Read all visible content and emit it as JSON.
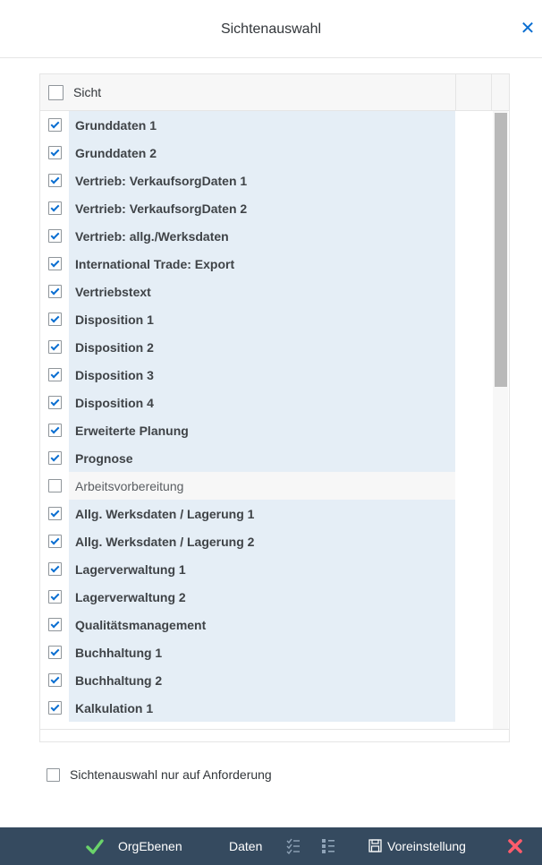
{
  "dialog": {
    "title": "Sichtenauswahl",
    "close_glyph": "✕"
  },
  "table": {
    "column_header": "Sicht",
    "header_checked": false,
    "rows": [
      {
        "label": "Grunddaten 1",
        "checked": true
      },
      {
        "label": "Grunddaten 2",
        "checked": true
      },
      {
        "label": "Vertrieb: VerkaufsorgDaten 1",
        "checked": true
      },
      {
        "label": "Vertrieb: VerkaufsorgDaten 2",
        "checked": true
      },
      {
        "label": "Vertrieb: allg./Werksdaten",
        "checked": true
      },
      {
        "label": "International Trade: Export",
        "checked": true
      },
      {
        "label": "Vertriebstext",
        "checked": true
      },
      {
        "label": "Disposition 1",
        "checked": true
      },
      {
        "label": "Disposition 2",
        "checked": true
      },
      {
        "label": "Disposition 3",
        "checked": true
      },
      {
        "label": "Disposition 4",
        "checked": true
      },
      {
        "label": "Erweiterte Planung",
        "checked": true
      },
      {
        "label": "Prognose",
        "checked": true
      },
      {
        "label": "Arbeitsvorbereitung",
        "checked": false
      },
      {
        "label": "Allg. Werksdaten / Lagerung 1",
        "checked": true
      },
      {
        "label": "Allg. Werksdaten / Lagerung 2",
        "checked": true
      },
      {
        "label": "Lagerverwaltung 1",
        "checked": true
      },
      {
        "label": "Lagerverwaltung 2",
        "checked": true
      },
      {
        "label": "Qualitätsmanagement",
        "checked": true
      },
      {
        "label": "Buchhaltung 1",
        "checked": true
      },
      {
        "label": "Buchhaltung 2",
        "checked": true
      },
      {
        "label": "Kalkulation 1",
        "checked": true
      }
    ]
  },
  "option": {
    "label": "Sichtenauswahl nur auf Anforderung",
    "checked": false
  },
  "footer": {
    "orgebenen_label": "OrgEbenen",
    "daten_label": "Daten",
    "voreinstellung_label": "Voreinstellung"
  },
  "colors": {
    "accent": "#0a6ed1",
    "footer_bg": "#354a5f",
    "selected_row_bg": "#e5eef6",
    "confirm_green": "#6ad36a",
    "cancel_red": "#ff5c6c"
  },
  "icons": [
    "close-icon",
    "checkmark-icon",
    "list-select-icon",
    "list-deselect-icon",
    "save-icon",
    "cancel-icon"
  ]
}
